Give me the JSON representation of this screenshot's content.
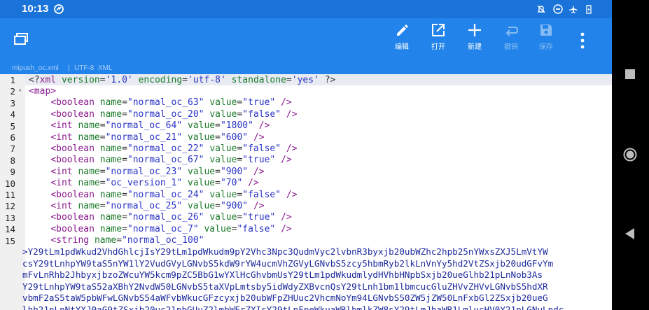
{
  "status_bar": {
    "time": "10:13",
    "icons": [
      "notifications-off-icon",
      "do-not-disturb-icon",
      "airplane-mode-icon",
      "battery-icon"
    ]
  },
  "toolbar": {
    "edit_label": "编辑",
    "open_label": "打开",
    "new_label": "新建",
    "undo_label": "撤销",
    "save_label": "保存"
  },
  "file_info": {
    "filename": "mipush_oc.xml",
    "encoding": "UTF-8",
    "syntax": "XML"
  },
  "editor": {
    "line_numbers": [
      "1",
      "2",
      "3",
      "4",
      "5",
      "6",
      "7",
      "8",
      "9",
      "10",
      "11",
      "12",
      "13",
      "14",
      "15"
    ],
    "lines": [
      {
        "indent": "",
        "parts": [
          [
            "pun",
            "<?"
          ],
          [
            "tag",
            "xml"
          ],
          [
            "pun",
            " "
          ],
          [
            "attr",
            "version"
          ],
          [
            "pun",
            "="
          ],
          [
            "val",
            "'1.0'"
          ],
          [
            "pun",
            " "
          ],
          [
            "attr",
            "encoding"
          ],
          [
            "pun",
            "="
          ],
          [
            "val",
            "'utf-8'"
          ],
          [
            "pun",
            " "
          ],
          [
            "attr",
            "standalone"
          ],
          [
            "pun",
            "="
          ],
          [
            "val",
            "'yes'"
          ],
          [
            "pun",
            " ?>"
          ]
        ]
      },
      {
        "indent": "",
        "parts": [
          [
            "tag",
            "<map>"
          ]
        ]
      },
      {
        "indent": "    ",
        "parts": [
          [
            "tag",
            "<boolean"
          ],
          [
            "pun",
            " "
          ],
          [
            "attr",
            "name"
          ],
          [
            "pun",
            "="
          ],
          [
            "val",
            "\"normal_oc_63\""
          ],
          [
            "pun",
            " "
          ],
          [
            "attr",
            "value"
          ],
          [
            "pun",
            "="
          ],
          [
            "val",
            "\"true\""
          ],
          [
            "pun",
            " "
          ],
          [
            "tag",
            "/>"
          ]
        ]
      },
      {
        "indent": "    ",
        "parts": [
          [
            "tag",
            "<boolean"
          ],
          [
            "pun",
            " "
          ],
          [
            "attr",
            "name"
          ],
          [
            "pun",
            "="
          ],
          [
            "val",
            "\"normal_oc_20\""
          ],
          [
            "pun",
            " "
          ],
          [
            "attr",
            "value"
          ],
          [
            "pun",
            "="
          ],
          [
            "val",
            "\"false\""
          ],
          [
            "pun",
            " "
          ],
          [
            "tag",
            "/>"
          ]
        ]
      },
      {
        "indent": "    ",
        "parts": [
          [
            "tag",
            "<int"
          ],
          [
            "pun",
            " "
          ],
          [
            "attr",
            "name"
          ],
          [
            "pun",
            "="
          ],
          [
            "val",
            "\"normal_oc_64\""
          ],
          [
            "pun",
            " "
          ],
          [
            "attr",
            "value"
          ],
          [
            "pun",
            "="
          ],
          [
            "val",
            "\"1800\""
          ],
          [
            "pun",
            " "
          ],
          [
            "tag",
            "/>"
          ]
        ]
      },
      {
        "indent": "    ",
        "parts": [
          [
            "tag",
            "<int"
          ],
          [
            "pun",
            " "
          ],
          [
            "attr",
            "name"
          ],
          [
            "pun",
            "="
          ],
          [
            "val",
            "\"normal_oc_21\""
          ],
          [
            "pun",
            " "
          ],
          [
            "attr",
            "value"
          ],
          [
            "pun",
            "="
          ],
          [
            "val",
            "\"600\""
          ],
          [
            "pun",
            " "
          ],
          [
            "tag",
            "/>"
          ]
        ]
      },
      {
        "indent": "    ",
        "parts": [
          [
            "tag",
            "<boolean"
          ],
          [
            "pun",
            " "
          ],
          [
            "attr",
            "name"
          ],
          [
            "pun",
            "="
          ],
          [
            "val",
            "\"normal_oc_22\""
          ],
          [
            "pun",
            " "
          ],
          [
            "attr",
            "value"
          ],
          [
            "pun",
            "="
          ],
          [
            "val",
            "\"false\""
          ],
          [
            "pun",
            " "
          ],
          [
            "tag",
            "/>"
          ]
        ]
      },
      {
        "indent": "    ",
        "parts": [
          [
            "tag",
            "<boolean"
          ],
          [
            "pun",
            " "
          ],
          [
            "attr",
            "name"
          ],
          [
            "pun",
            "="
          ],
          [
            "val",
            "\"normal_oc_67\""
          ],
          [
            "pun",
            " "
          ],
          [
            "attr",
            "value"
          ],
          [
            "pun",
            "="
          ],
          [
            "val",
            "\"true\""
          ],
          [
            "pun",
            " "
          ],
          [
            "tag",
            "/>"
          ]
        ]
      },
      {
        "indent": "    ",
        "parts": [
          [
            "tag",
            "<int"
          ],
          [
            "pun",
            " "
          ],
          [
            "attr",
            "name"
          ],
          [
            "pun",
            "="
          ],
          [
            "val",
            "\"normal_oc_23\""
          ],
          [
            "pun",
            " "
          ],
          [
            "attr",
            "value"
          ],
          [
            "pun",
            "="
          ],
          [
            "val",
            "\"900\""
          ],
          [
            "pun",
            " "
          ],
          [
            "tag",
            "/>"
          ]
        ]
      },
      {
        "indent": "    ",
        "parts": [
          [
            "tag",
            "<int"
          ],
          [
            "pun",
            " "
          ],
          [
            "attr",
            "name"
          ],
          [
            "pun",
            "="
          ],
          [
            "val",
            "\"oc_version_1\""
          ],
          [
            "pun",
            " "
          ],
          [
            "attr",
            "value"
          ],
          [
            "pun",
            "="
          ],
          [
            "val",
            "\"70\""
          ],
          [
            "pun",
            " "
          ],
          [
            "tag",
            "/>"
          ]
        ]
      },
      {
        "indent": "    ",
        "parts": [
          [
            "tag",
            "<boolean"
          ],
          [
            "pun",
            " "
          ],
          [
            "attr",
            "name"
          ],
          [
            "pun",
            "="
          ],
          [
            "val",
            "\"normal_oc_24\""
          ],
          [
            "pun",
            " "
          ],
          [
            "attr",
            "value"
          ],
          [
            "pun",
            "="
          ],
          [
            "val",
            "\"false\""
          ],
          [
            "pun",
            " "
          ],
          [
            "tag",
            "/>"
          ]
        ]
      },
      {
        "indent": "    ",
        "parts": [
          [
            "tag",
            "<int"
          ],
          [
            "pun",
            " "
          ],
          [
            "attr",
            "name"
          ],
          [
            "pun",
            "="
          ],
          [
            "val",
            "\"normal_oc_25\""
          ],
          [
            "pun",
            " "
          ],
          [
            "attr",
            "value"
          ],
          [
            "pun",
            "="
          ],
          [
            "val",
            "\"900\""
          ],
          [
            "pun",
            " "
          ],
          [
            "tag",
            "/>"
          ]
        ]
      },
      {
        "indent": "    ",
        "parts": [
          [
            "tag",
            "<boolean"
          ],
          [
            "pun",
            " "
          ],
          [
            "attr",
            "name"
          ],
          [
            "pun",
            "="
          ],
          [
            "val",
            "\"normal_oc_26\""
          ],
          [
            "pun",
            " "
          ],
          [
            "attr",
            "value"
          ],
          [
            "pun",
            "="
          ],
          [
            "val",
            "\"true\""
          ],
          [
            "pun",
            " "
          ],
          [
            "tag",
            "/>"
          ]
        ]
      },
      {
        "indent": "    ",
        "parts": [
          [
            "tag",
            "<boolean"
          ],
          [
            "pun",
            " "
          ],
          [
            "attr",
            "name"
          ],
          [
            "pun",
            "="
          ],
          [
            "val",
            "\"normal_oc_7\""
          ],
          [
            "pun",
            " "
          ],
          [
            "attr",
            "value"
          ],
          [
            "pun",
            "="
          ],
          [
            "val",
            "\"false\""
          ],
          [
            "pun",
            " "
          ],
          [
            "tag",
            "/>"
          ]
        ]
      },
      {
        "indent": "    ",
        "parts": [
          [
            "tag",
            "<string"
          ],
          [
            "pun",
            " "
          ],
          [
            "attr",
            "name"
          ],
          [
            "pun",
            "="
          ],
          [
            "val",
            "\"normal_oc_100\""
          ]
        ]
      }
    ],
    "base64_lines": [
      ">Y29tLm1pdWkud2VhdGhlcjIsY29tLm1pdWkudm9pY2Vhc3Npc3QudmVyc2lvbnR3byxjb20ubWZhc2hpb25nYWxsZXJ5LmVtYW",
      "csY29tLnhpYW9taS5nYW1lY2VudGVyLGNvbS5kdW9rYW4ucmVhZGVyLGNvbS5zcy5hbmRyb2lkLnVnYy5hd2VtZSxjb20udGFvYm",
      "mFvLnRhb2JhbyxjbzoZWcuYW5kcm9pZC5BbG1wYXlHcGhvbmUsY29tLm1pdWkudmlydHVhbHNpbSxjb20ueGlhb21pLnNob3As",
      "Y29tLnhpYW9taS52aXBhY2NvdW50LGNvbS5taXVpLmtsby5idWdyZXBvcnQsY29tLnh1bm1lbmcucGluZHVvZHVvLGNvbS5hdXR",
      "vbmF2aS5taW5pbWFwLGNvbS54aWFvbWkucGFzcyxjb20ubWFpZHUuc2VhcmNoYm94LGNvbS50ZW5jZW50LnFxbGl2ZSxjb20ueG",
      "lhb21pLnNtYXJ0aG9tZSxjb20uc21pbGUuZ2lmbWFrZXIsY29tLnFpeWkuaWRlbmlkZW8sY29tLmJhaWR1LmlucHV0Y21pLGNuLndc"
    ]
  }
}
